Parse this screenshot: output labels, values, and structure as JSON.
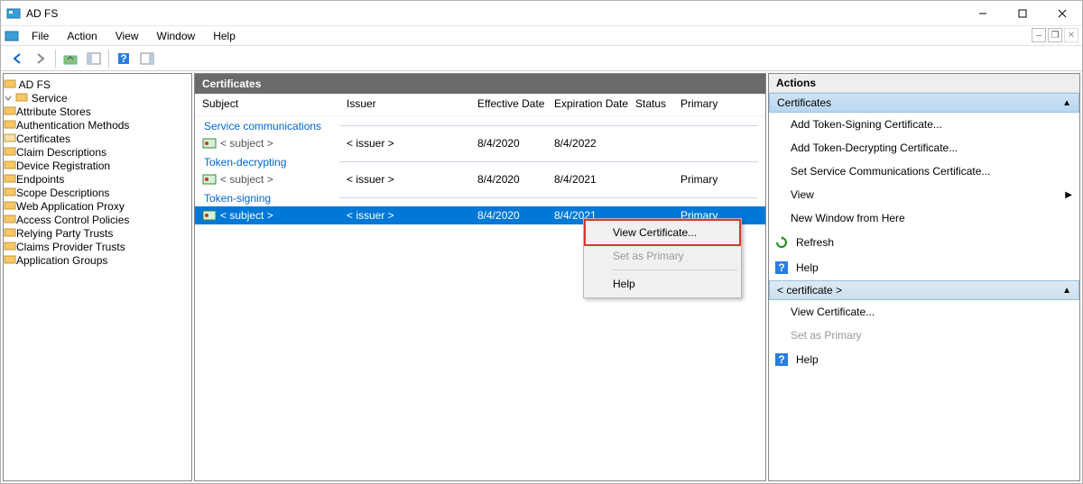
{
  "title": "AD FS",
  "menu": {
    "file": "File",
    "action": "Action",
    "view": "View",
    "window": "Window",
    "help": "Help"
  },
  "tree": {
    "root": "AD FS",
    "service": "Service",
    "service_children": [
      "Attribute Stores",
      "Authentication Methods",
      "Certificates",
      "Claim Descriptions",
      "Device Registration",
      "Endpoints",
      "Scope Descriptions",
      "Web Application Proxy"
    ],
    "siblings": [
      "Access Control Policies",
      "Relying Party Trusts",
      "Claims Provider Trusts",
      "Application Groups"
    ]
  },
  "center": {
    "title": "Certificates",
    "cols": {
      "subject": "Subject",
      "issuer": "Issuer",
      "eff": "Effective Date",
      "exp": "Expiration Date",
      "status": "Status",
      "primary": "Primary"
    },
    "groups": [
      {
        "name": "Service communications",
        "rows": [
          {
            "subject": "< subject >",
            "issuer": "< issuer >",
            "eff": "8/4/2020",
            "exp": "8/4/2022",
            "status": "",
            "primary": ""
          }
        ]
      },
      {
        "name": "Token-decrypting",
        "rows": [
          {
            "subject": "< subject >",
            "issuer": "< issuer >",
            "eff": "8/4/2020",
            "exp": "8/4/2021",
            "status": "",
            "primary": "Primary"
          }
        ]
      },
      {
        "name": "Token-signing",
        "rows": [
          {
            "subject": "< subject >",
            "issuer": "< issuer >",
            "eff": "8/4/2020",
            "exp": "8/4/2021",
            "status": "",
            "primary": "Primary",
            "selected": true
          }
        ]
      }
    ]
  },
  "contextMenu": {
    "view": "View Certificate...",
    "setPrimary": "Set as Primary",
    "help": "Help"
  },
  "actions": {
    "title": "Actions",
    "group1": {
      "header": "Certificates",
      "items": {
        "addSigning": "Add Token-Signing Certificate...",
        "addDecrypt": "Add Token-Decrypting Certificate...",
        "setComm": "Set Service Communications Certificate...",
        "view": "View",
        "newWindow": "New Window from Here",
        "refresh": "Refresh",
        "help": "Help"
      }
    },
    "group2": {
      "header": "< certificate >",
      "items": {
        "viewCert": "View Certificate...",
        "setPrimary": "Set as Primary",
        "help": "Help"
      }
    }
  }
}
